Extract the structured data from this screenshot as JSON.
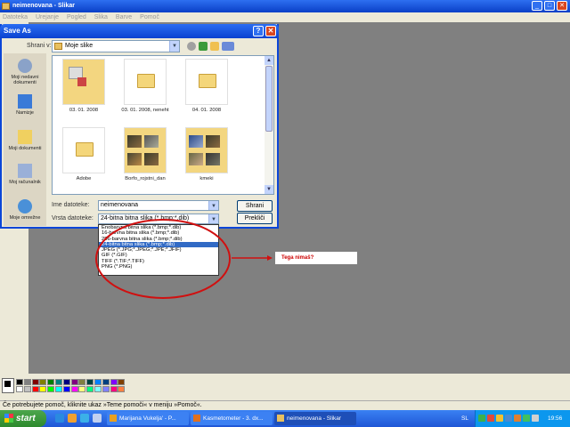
{
  "window": {
    "title": "neimenovana - Slikar",
    "minimize": "_",
    "maximize": "□",
    "close": "✕",
    "menu": [
      "Datoteka",
      "Urejanje",
      "Pogled",
      "Slika",
      "Barve",
      "Pomoč"
    ]
  },
  "dialog": {
    "title": "Save As",
    "help": "?",
    "close": "✕",
    "save_in_label": "Shrani v:",
    "save_in_value": "Moje slike",
    "places": [
      "Moji nedavni dokumenti",
      "Namizje",
      "Moji dokumenti",
      "Moj računalnik",
      "Moje omrežne"
    ],
    "files": [
      {
        "name": "03. 01. 2008",
        "icon": "folder-preview-icon"
      },
      {
        "name": "03. 01. 2008, neneht",
        "icon": "folder-icon"
      },
      {
        "name": "04. 01. 2008",
        "icon": "folder-icon"
      },
      {
        "name": "Adobe",
        "icon": "folder-icon"
      },
      {
        "name": "Borfo_rojstni_dan",
        "icon": "folder-photos-icon"
      },
      {
        "name": "kmeki",
        "icon": "folder-photos-icon"
      }
    ],
    "filename_label": "Ime datoteke:",
    "filename_value": "neimenovana",
    "filetype_label": "Vrsta datoteke:",
    "filetype_value": "24-bitna bitna slika (*.bmp;*.dib)",
    "save_button": "Shrani",
    "cancel_button": "Prekliči",
    "type_options": [
      "Enobarvna bitna slika (*.bmp;*.dib)",
      "16-barvna bitna slika (*.bmp;*.dib)",
      "256-barvna bitna slika (*.bmp;*.dib)",
      "24-bitna bitna slika (*.bmp;*.dib)",
      "JPEG (*.JPG;*.JPEG;*.JPE;*.JFIF)",
      "GIF (*.GIF)",
      "TIFF (*.TIF;*.TIFF)",
      "PNG (*.PNG)"
    ],
    "selected_option_index": 3
  },
  "annotation": {
    "text": "Tega nimaš?",
    "color": "#cc0000"
  },
  "palette": [
    "#000000",
    "#808080",
    "#800000",
    "#808000",
    "#008000",
    "#008080",
    "#000080",
    "#800080",
    "#808040",
    "#004040",
    "#0080ff",
    "#004080",
    "#8000ff",
    "#804000",
    "#ffffff",
    "#c0c0c0",
    "#ff0000",
    "#ffff00",
    "#00ff00",
    "#00ffff",
    "#0000ff",
    "#ff00ff",
    "#ffff80",
    "#00ff80",
    "#80ffff",
    "#8080ff",
    "#ff0080",
    "#ff8040"
  ],
  "statusbar": {
    "text": "Če potrebujete pomoč, kliknite ukaz »Teme pomoči« v meniju »Pomoč«."
  },
  "taskbar": {
    "start": "start",
    "tasks": [
      "Marijana Vukelja' - P...",
      "Kasmetometer - 3. dx...",
      "neimenovana - Slikar"
    ],
    "lang": "SL",
    "clock": "19:56"
  }
}
